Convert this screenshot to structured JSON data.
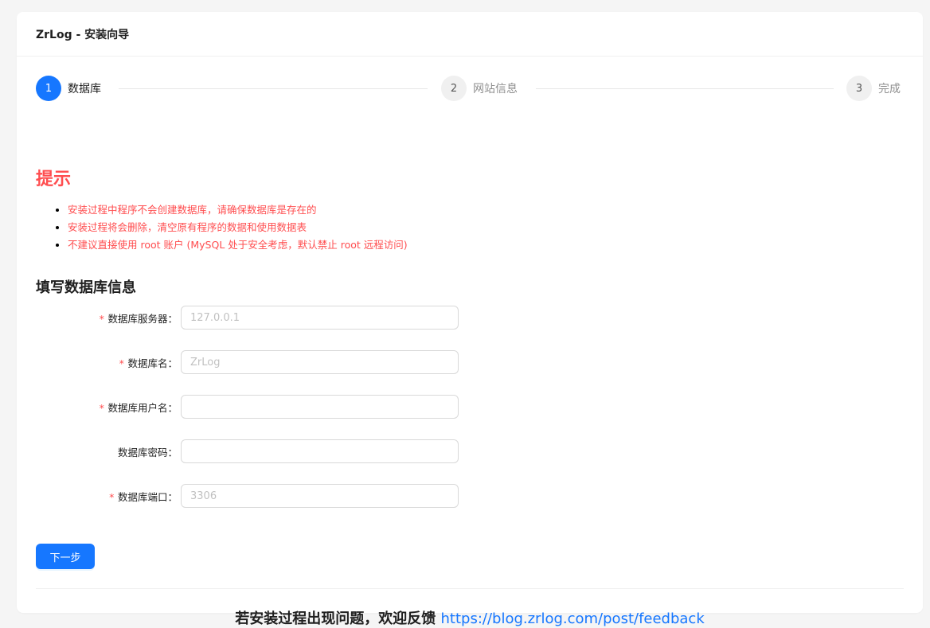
{
  "header": {
    "title": "ZrLog - 安装向导"
  },
  "steps": [
    {
      "number": "1",
      "label": "数据库",
      "active": true
    },
    {
      "number": "2",
      "label": "网站信息",
      "active": false
    },
    {
      "number": "3",
      "label": "完成",
      "active": false
    }
  ],
  "tips": {
    "title": "提示",
    "items": [
      "安装过程中程序不会创建数据库，请确保数据库是存在的",
      "安装过程将会删除，清空原有程序的数据和使用数据表",
      "不建议直接使用 root 账户 (MySQL 处于安全考虑，默认禁止 root 远程访问)"
    ]
  },
  "form": {
    "title": "填写数据库信息",
    "fields": [
      {
        "label": "数据库服务器",
        "required": "*",
        "placeholder": "127.0.0.1",
        "value": ""
      },
      {
        "label": "数据库名",
        "required": "*",
        "placeholder": "ZrLog",
        "value": ""
      },
      {
        "label": "数据库用户名",
        "required": "*",
        "placeholder": "",
        "value": ""
      },
      {
        "label": "数据库密码",
        "required": "",
        "placeholder": "",
        "value": ""
      },
      {
        "label": "数据库端口",
        "required": "*",
        "placeholder": "3306",
        "value": ""
      }
    ],
    "label_suffix": "：",
    "next_label": "下一步"
  },
  "footer": {
    "text": "若安装过程出现问题，欢迎反馈 ",
    "link": "https://blog.zrlog.com/post/feedback"
  },
  "colors": {
    "primary": "#1677ff",
    "danger": "#ff4d4f",
    "background": "#f5f5f5"
  }
}
